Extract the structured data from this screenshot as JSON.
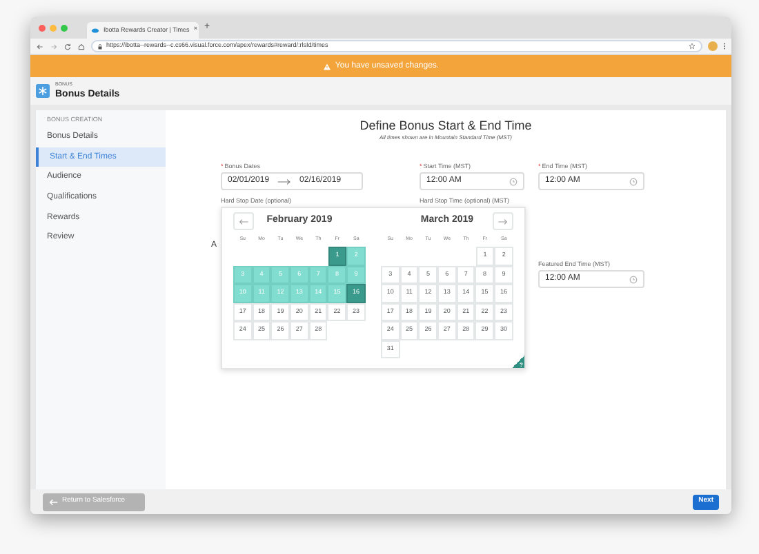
{
  "browser": {
    "tab": {
      "title": "Ibotta Rewards Creator | Times",
      "close": "×"
    },
    "new_tab": "+",
    "url": "https://ibotta--rewards--c.cs66.visual.force.com/apex/rewards#reward/:rlsId/times"
  },
  "banner": {
    "message": "You have unsaved changes."
  },
  "header": {
    "eyebrow": "BONUS",
    "title": "Bonus Details"
  },
  "sidebar": {
    "heading": "BONUS CREATION",
    "items": [
      {
        "label": "Bonus Details",
        "selected": false
      },
      {
        "label": "Start & End Times",
        "selected": true
      },
      {
        "label": "Audience",
        "selected": false
      },
      {
        "label": "Qualifications",
        "selected": false
      },
      {
        "label": "Rewards",
        "selected": false
      },
      {
        "label": "Review",
        "selected": false
      }
    ]
  },
  "main": {
    "title": "Define Bonus Start & End Time",
    "subtitle": "All times shown are in Mountain Standard Time (MST)",
    "bonus_dates": {
      "required": true,
      "required_mark": "*",
      "label": "Bonus Dates",
      "start": "02/01/2019",
      "end": "02/16/2019"
    },
    "start_time": {
      "required": true,
      "required_mark": "*",
      "label": "Start Time (MST)",
      "value": "12:00 AM"
    },
    "end_time": {
      "required": true,
      "required_mark": "*",
      "label": "End Time (MST)",
      "value": "12:00 AM"
    },
    "hard_stop_date": {
      "label": "Hard Stop Date (optional)"
    },
    "hard_stop_time": {
      "label": "Hard Stop Time (optional) (MST)"
    },
    "partial_label": "A",
    "featured_end_time": {
      "label": "Featured End Time (MST)",
      "value": "12:00 AM"
    }
  },
  "calendar": {
    "shortcut_badge": "?",
    "months": [
      {
        "title": "February 2019",
        "weekdays": [
          "Su",
          "Mo",
          "Tu",
          "We",
          "Th",
          "Fr",
          "Sa"
        ],
        "weeks": [
          {
            "right_aligned": true,
            "days": [
              {
                "day": "1",
                "in_range": true,
                "endpoint": true
              },
              {
                "day": "2",
                "in_range": true,
                "endpoint": false
              }
            ]
          },
          {
            "right_aligned": false,
            "days": [
              {
                "day": "3",
                "in_range": true,
                "endpoint": false
              },
              {
                "day": "4",
                "in_range": true,
                "endpoint": false
              },
              {
                "day": "5",
                "in_range": true,
                "endpoint": false
              },
              {
                "day": "6",
                "in_range": true,
                "endpoint": false
              },
              {
                "day": "7",
                "in_range": true,
                "endpoint": false
              },
              {
                "day": "8",
                "in_range": true,
                "endpoint": false
              },
              {
                "day": "9",
                "in_range": true,
                "endpoint": false
              }
            ]
          },
          {
            "right_aligned": false,
            "days": [
              {
                "day": "10",
                "in_range": true,
                "endpoint": false
              },
              {
                "day": "11",
                "in_range": true,
                "endpoint": false
              },
              {
                "day": "12",
                "in_range": true,
                "endpoint": false
              },
              {
                "day": "13",
                "in_range": true,
                "endpoint": false
              },
              {
                "day": "14",
                "in_range": true,
                "endpoint": false
              },
              {
                "day": "15",
                "in_range": true,
                "endpoint": false
              },
              {
                "day": "16",
                "in_range": true,
                "endpoint": true
              }
            ]
          },
          {
            "right_aligned": false,
            "days": [
              {
                "day": "17",
                "in_range": false,
                "endpoint": false
              },
              {
                "day": "18",
                "in_range": false,
                "endpoint": false
              },
              {
                "day": "19",
                "in_range": false,
                "endpoint": false
              },
              {
                "day": "20",
                "in_range": false,
                "endpoint": false
              },
              {
                "day": "21",
                "in_range": false,
                "endpoint": false
              },
              {
                "day": "22",
                "in_range": false,
                "endpoint": false
              },
              {
                "day": "23",
                "in_range": false,
                "endpoint": false
              }
            ]
          },
          {
            "right_aligned": false,
            "days": [
              {
                "day": "24",
                "in_range": false,
                "endpoint": false
              },
              {
                "day": "25",
                "in_range": false,
                "endpoint": false
              },
              {
                "day": "26",
                "in_range": false,
                "endpoint": false
              },
              {
                "day": "27",
                "in_range": false,
                "endpoint": false
              },
              {
                "day": "28",
                "in_range": false,
                "endpoint": false
              }
            ]
          }
        ]
      },
      {
        "title": "March 2019",
        "weekdays": [
          "Su",
          "Mo",
          "Tu",
          "We",
          "Th",
          "Fr",
          "Sa"
        ],
        "weeks": [
          {
            "right_aligned": true,
            "days": [
              {
                "day": "1",
                "in_range": false,
                "endpoint": false
              },
              {
                "day": "2",
                "in_range": false,
                "endpoint": false
              }
            ]
          },
          {
            "right_aligned": false,
            "days": [
              {
                "day": "3",
                "in_range": false,
                "endpoint": false
              },
              {
                "day": "4",
                "in_range": false,
                "endpoint": false
              },
              {
                "day": "5",
                "in_range": false,
                "endpoint": false
              },
              {
                "day": "6",
                "in_range": false,
                "endpoint": false
              },
              {
                "day": "7",
                "in_range": false,
                "endpoint": false
              },
              {
                "day": "8",
                "in_range": false,
                "endpoint": false
              },
              {
                "day": "9",
                "in_range": false,
                "endpoint": false
              }
            ]
          },
          {
            "right_aligned": false,
            "days": [
              {
                "day": "10",
                "in_range": false,
                "endpoint": false
              },
              {
                "day": "11",
                "in_range": false,
                "endpoint": false
              },
              {
                "day": "12",
                "in_range": false,
                "endpoint": false
              },
              {
                "day": "13",
                "in_range": false,
                "endpoint": false
              },
              {
                "day": "14",
                "in_range": false,
                "endpoint": false
              },
              {
                "day": "15",
                "in_range": false,
                "endpoint": false
              },
              {
                "day": "16",
                "in_range": false,
                "endpoint": false
              }
            ]
          },
          {
            "right_aligned": false,
            "days": [
              {
                "day": "17",
                "in_range": false,
                "endpoint": false
              },
              {
                "day": "18",
                "in_range": false,
                "endpoint": false
              },
              {
                "day": "19",
                "in_range": false,
                "endpoint": false
              },
              {
                "day": "20",
                "in_range": false,
                "endpoint": false
              },
              {
                "day": "21",
                "in_range": false,
                "endpoint": false
              },
              {
                "day": "22",
                "in_range": false,
                "endpoint": false
              },
              {
                "day": "23",
                "in_range": false,
                "endpoint": false
              }
            ]
          },
          {
            "right_aligned": false,
            "days": [
              {
                "day": "24",
                "in_range": false,
                "endpoint": false
              },
              {
                "day": "25",
                "in_range": false,
                "endpoint": false
              },
              {
                "day": "26",
                "in_range": false,
                "endpoint": false
              },
              {
                "day": "27",
                "in_range": false,
                "endpoint": false
              },
              {
                "day": "28",
                "in_range": false,
                "endpoint": false
              },
              {
                "day": "29",
                "in_range": false,
                "endpoint": false
              },
              {
                "day": "30",
                "in_range": false,
                "endpoint": false
              }
            ]
          },
          {
            "right_aligned": false,
            "days": [
              {
                "day": "31",
                "in_range": false,
                "endpoint": false
              }
            ]
          }
        ]
      }
    ]
  },
  "footer": {
    "back": {
      "label": "Return to Salesforce",
      "disabled": true
    },
    "next": {
      "label": "Next"
    }
  }
}
